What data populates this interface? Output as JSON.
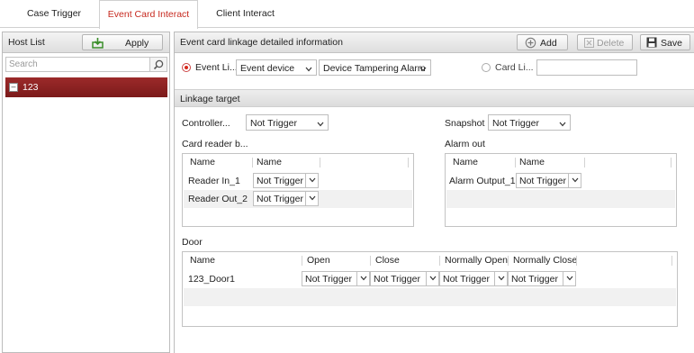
{
  "tabs": [
    {
      "label": "Case Trigger"
    },
    {
      "label": "Event Card Interact"
    },
    {
      "label": "Client Interact"
    }
  ],
  "left": {
    "title": "Host List",
    "apply_label": "Apply",
    "search_placeholder": "Search",
    "hosts": [
      {
        "label": "123"
      }
    ]
  },
  "right": {
    "title": "Event card linkage detailed information",
    "add_label": "Add",
    "delete_label": "Delete",
    "save_label": "Save",
    "event_linkage_label": "Event Li...",
    "event_source_value": "Event device",
    "event_type_value": "Device Tampering Alarm",
    "card_linkage_label": "Card Li...",
    "card_value": "",
    "linkage_target_title": "Linkage target",
    "controller_label": "Controller...",
    "controller_value": "Not Trigger",
    "snapshot_label": "Snapshot",
    "snapshot_value": "Not Trigger",
    "card_reader_label": "Card reader b...",
    "alarm_out_label": "Alarm out",
    "card_reader_table": {
      "headers": [
        "Name",
        "Name"
      ],
      "rows": [
        {
          "name": "Reader In_1",
          "value": "Not Trigger"
        },
        {
          "name": "Reader Out_2",
          "value": "Not Trigger"
        }
      ]
    },
    "alarm_out_table": {
      "headers": [
        "Name",
        "Name"
      ],
      "rows": [
        {
          "name": "Alarm Output_1",
          "value": "Not Trigger"
        }
      ]
    },
    "door_label": "Door",
    "door_table": {
      "headers": [
        "Name",
        "Open",
        "Close",
        "Normally Open",
        "Normally Close"
      ],
      "rows": [
        {
          "name": "123_Door1",
          "open": "Not Trigger",
          "close": "Not Trigger",
          "normally_open": "Not Trigger",
          "normally_close": "Not Trigger"
        }
      ]
    }
  },
  "colors": {
    "active_tab": "#c72a20",
    "selected_host_bg": "#8b2020",
    "radio_on": "#d7281c",
    "apply_icon": "#3b8e2a"
  }
}
